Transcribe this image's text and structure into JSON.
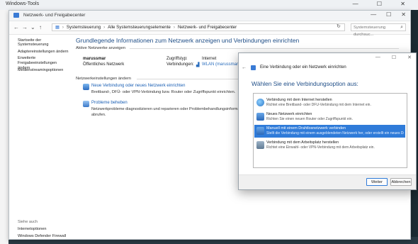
{
  "background_window": {
    "title": "Windows-Tools"
  },
  "window": {
    "title": "Netzwerk- und Freigabecenter",
    "controls": {
      "minimize": "—",
      "maximize": "☐",
      "close": "✕"
    }
  },
  "address": {
    "breadcrumb": [
      "Systemsteuerung",
      "Alle Systemsteuerungselemente",
      "Netzwerk- und Freigabecenter"
    ],
    "search_placeholder": "Systemsteuerung durchsuc..."
  },
  "sidebar": {
    "items": [
      "Startseite der Systemsteuerung",
      "Adaptereinstellungen ändern",
      "Erweiterte Freigabeeinstellungen ändern",
      "Medienstreamingoptionen"
    ],
    "see_also_label": "Siehe auch",
    "see_also": [
      "Internetoptionen",
      "Windows Defender Firewall"
    ]
  },
  "main": {
    "heading": "Grundlegende Informationen zum Netzwerk anzeigen und Verbindungen einrichten",
    "active_networks_label": "Aktive Netzwerke anzeigen",
    "network_name": "marussmar",
    "network_type": "Öffentliches Netzwerk",
    "access_type_label": "Zugriffstyp:",
    "access_type_value": "Internet",
    "connections_label": "Verbindungen:",
    "connections_value": "WLAN (marussmar)",
    "change_settings_label": "Netzwerkeinstellungen ändern",
    "tasks": [
      {
        "title": "Neue Verbindung oder neues Netzwerk einrichten",
        "desc": "Breitband-, DFÜ- oder VPN-Verbindung bzw. Router oder Zugriffspunkt einrichten."
      },
      {
        "title": "Probleme beheben",
        "desc": "Netzwerkprobleme diagnostizieren und reparieren oder Problembehandlungsinformationen abrufen."
      }
    ]
  },
  "dialog": {
    "title": "Eine Verbindung oder ein Netzwerk einrichten",
    "question": "Wählen Sie eine Verbindungsoption aus:",
    "options": [
      {
        "title": "Verbindung mit dem Internet herstellen",
        "desc": "Richtet eine Breitband- oder DFÜ-Verbindung mit dem Internet ein.",
        "icon": "globe-icon"
      },
      {
        "title": "Neues Netzwerk einrichten",
        "desc": "Richten Sie einen neuen Router oder Zugriffspunkt ein.",
        "icon": "router-icon"
      },
      {
        "title": "Manuell mit einem Drahtlosnetzwerk verbinden",
        "desc": "Stellt die Verbindung mit einem ausgeblendeten Netzwerk her, oder erstellt ein neues Dr...",
        "icon": "wireless-icon"
      },
      {
        "title": "Verbindung mit dem Arbeitsplatz herstellen",
        "desc": "Richtet eine Einwahl- oder VPN-Verbindung mit dem Arbeitsplatz ein.",
        "icon": "workplace-icon"
      }
    ],
    "selected_index": 2,
    "next_button": "Weiter",
    "cancel_button": "Abbrechen"
  },
  "colors": {
    "accent": "#2f7bd9",
    "heading": "#1f4e87",
    "link": "#1a5fb4"
  }
}
